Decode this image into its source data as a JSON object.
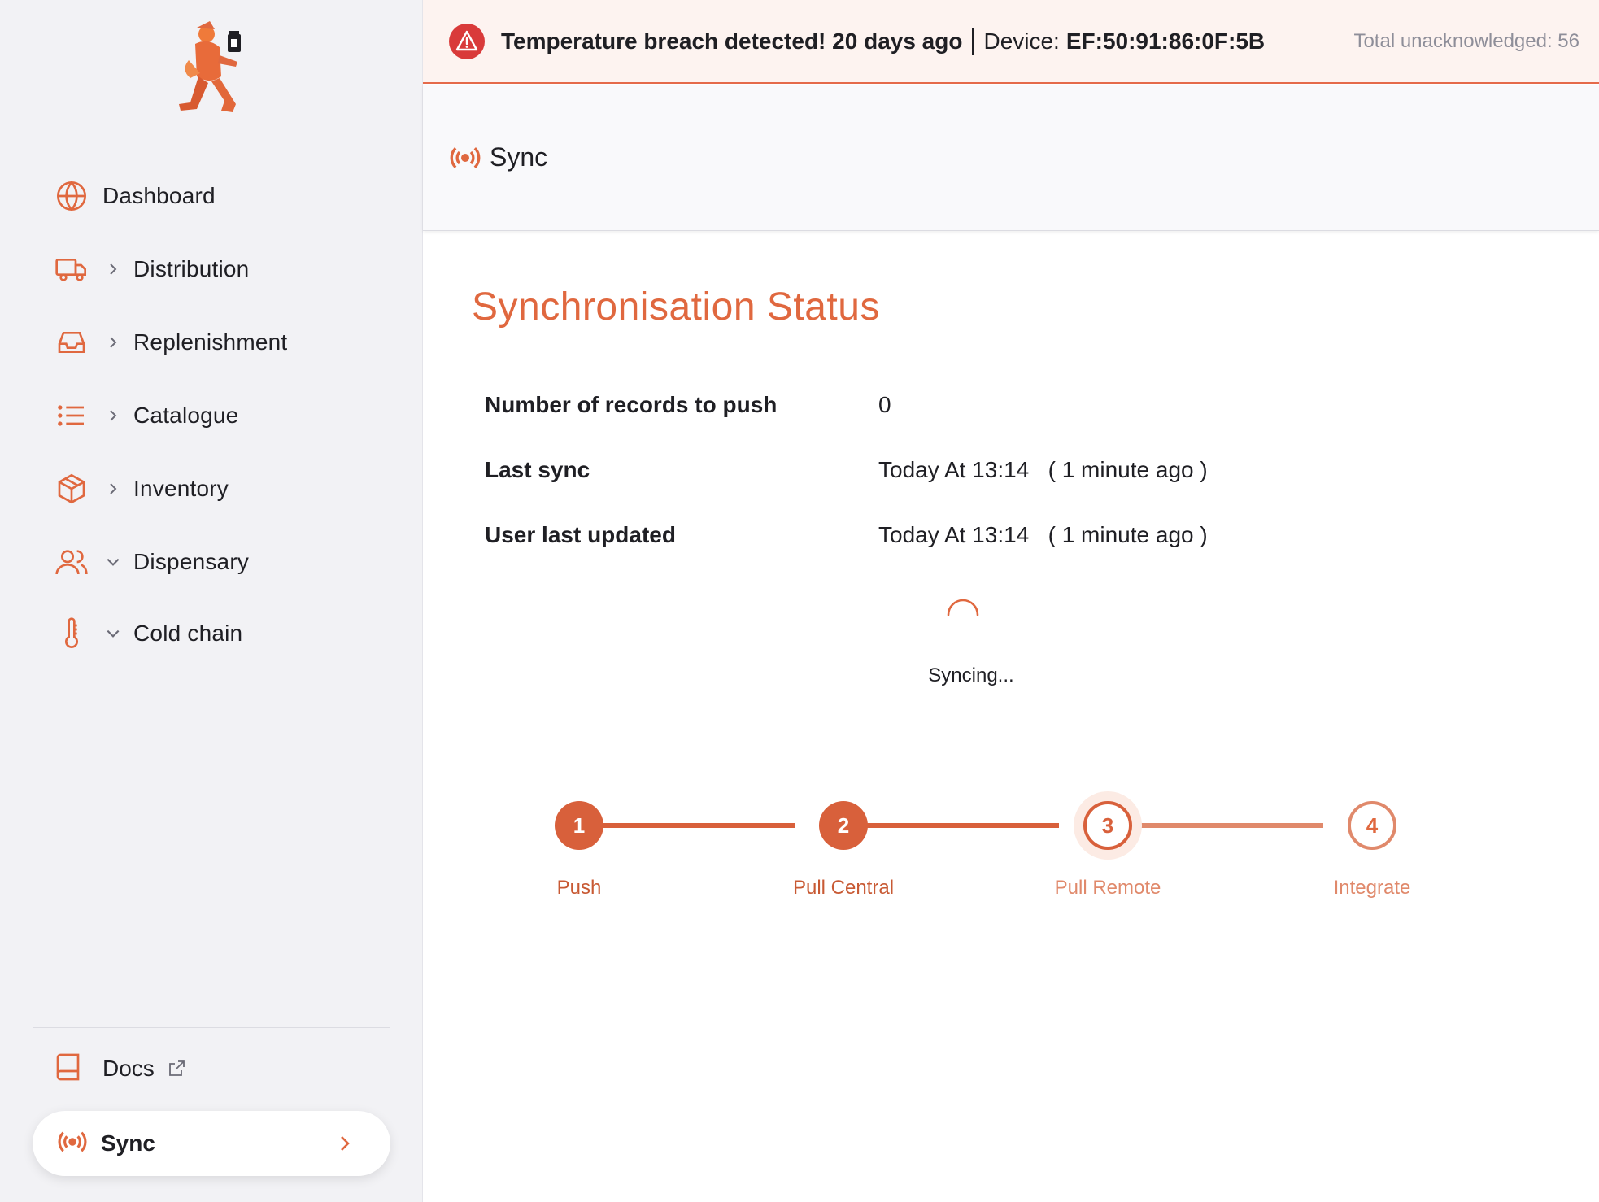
{
  "sidebar": {
    "items": [
      {
        "label": "Dashboard",
        "icon": "globe-icon",
        "chevron": "none"
      },
      {
        "label": "Distribution",
        "icon": "truck-icon",
        "chevron": "right"
      },
      {
        "label": "Replenishment",
        "icon": "inbox-icon",
        "chevron": "right"
      },
      {
        "label": "Catalogue",
        "icon": "list-icon",
        "chevron": "right"
      },
      {
        "label": "Inventory",
        "icon": "box-icon",
        "chevron": "right"
      },
      {
        "label": "Dispensary",
        "icon": "users-icon",
        "chevron": "down"
      },
      {
        "label": "Cold chain",
        "icon": "thermometer-icon",
        "chevron": "down"
      }
    ],
    "docs_label": "Docs",
    "sync_label": "Sync"
  },
  "alert": {
    "message": "Temperature breach detected! 20 days ago",
    "device_label": "Device:",
    "device_id": "EF:50:91:86:0F:5B",
    "unacknowledged": "Total unacknowledged: 56"
  },
  "header": {
    "title": "Sync"
  },
  "main": {
    "title": "Synchronisation Status",
    "rows": [
      {
        "key": "Number of records to push",
        "value": "0"
      },
      {
        "key": "Last sync",
        "value": "Today At 13:14   ( 1 minute ago )"
      },
      {
        "key": "User last updated",
        "value": "Today At 13:14   ( 1 minute ago )"
      }
    ],
    "status_text": "Syncing..."
  },
  "stepper": {
    "steps": [
      {
        "number": "1",
        "label": "Push",
        "state": "done"
      },
      {
        "number": "2",
        "label": "Pull Central",
        "state": "done"
      },
      {
        "number": "3",
        "label": "Pull Remote",
        "state": "active"
      },
      {
        "number": "4",
        "label": "Integrate",
        "state": "todo"
      }
    ]
  },
  "colors": {
    "accent": "#e0683f",
    "accent_dark": "#d8603b",
    "alert_bg": "#fdf3f0",
    "alert_icon": "#d93a3a",
    "sidebar_bg": "#f2f2f5"
  }
}
